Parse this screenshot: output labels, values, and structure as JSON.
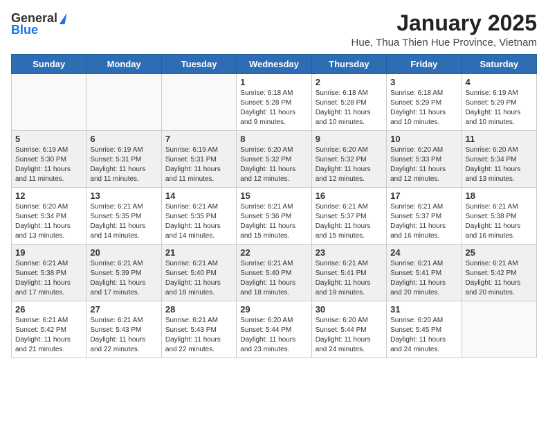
{
  "header": {
    "logo_general": "General",
    "logo_blue": "Blue",
    "month_title": "January 2025",
    "subtitle": "Hue, Thua Thien Hue Province, Vietnam"
  },
  "days_of_week": [
    "Sunday",
    "Monday",
    "Tuesday",
    "Wednesday",
    "Thursday",
    "Friday",
    "Saturday"
  ],
  "weeks": [
    {
      "shaded": false,
      "days": [
        {
          "num": "",
          "info": ""
        },
        {
          "num": "",
          "info": ""
        },
        {
          "num": "",
          "info": ""
        },
        {
          "num": "1",
          "info": "Sunrise: 6:18 AM\nSunset: 5:28 PM\nDaylight: 11 hours and 9 minutes."
        },
        {
          "num": "2",
          "info": "Sunrise: 6:18 AM\nSunset: 5:28 PM\nDaylight: 11 hours and 10 minutes."
        },
        {
          "num": "3",
          "info": "Sunrise: 6:18 AM\nSunset: 5:29 PM\nDaylight: 11 hours and 10 minutes."
        },
        {
          "num": "4",
          "info": "Sunrise: 6:19 AM\nSunset: 5:29 PM\nDaylight: 11 hours and 10 minutes."
        }
      ]
    },
    {
      "shaded": true,
      "days": [
        {
          "num": "5",
          "info": "Sunrise: 6:19 AM\nSunset: 5:30 PM\nDaylight: 11 hours and 11 minutes."
        },
        {
          "num": "6",
          "info": "Sunrise: 6:19 AM\nSunset: 5:31 PM\nDaylight: 11 hours and 11 minutes."
        },
        {
          "num": "7",
          "info": "Sunrise: 6:19 AM\nSunset: 5:31 PM\nDaylight: 11 hours and 11 minutes."
        },
        {
          "num": "8",
          "info": "Sunrise: 6:20 AM\nSunset: 5:32 PM\nDaylight: 11 hours and 12 minutes."
        },
        {
          "num": "9",
          "info": "Sunrise: 6:20 AM\nSunset: 5:32 PM\nDaylight: 11 hours and 12 minutes."
        },
        {
          "num": "10",
          "info": "Sunrise: 6:20 AM\nSunset: 5:33 PM\nDaylight: 11 hours and 12 minutes."
        },
        {
          "num": "11",
          "info": "Sunrise: 6:20 AM\nSunset: 5:34 PM\nDaylight: 11 hours and 13 minutes."
        }
      ]
    },
    {
      "shaded": false,
      "days": [
        {
          "num": "12",
          "info": "Sunrise: 6:20 AM\nSunset: 5:34 PM\nDaylight: 11 hours and 13 minutes."
        },
        {
          "num": "13",
          "info": "Sunrise: 6:21 AM\nSunset: 5:35 PM\nDaylight: 11 hours and 14 minutes."
        },
        {
          "num": "14",
          "info": "Sunrise: 6:21 AM\nSunset: 5:35 PM\nDaylight: 11 hours and 14 minutes."
        },
        {
          "num": "15",
          "info": "Sunrise: 6:21 AM\nSunset: 5:36 PM\nDaylight: 11 hours and 15 minutes."
        },
        {
          "num": "16",
          "info": "Sunrise: 6:21 AM\nSunset: 5:37 PM\nDaylight: 11 hours and 15 minutes."
        },
        {
          "num": "17",
          "info": "Sunrise: 6:21 AM\nSunset: 5:37 PM\nDaylight: 11 hours and 16 minutes."
        },
        {
          "num": "18",
          "info": "Sunrise: 6:21 AM\nSunset: 5:38 PM\nDaylight: 11 hours and 16 minutes."
        }
      ]
    },
    {
      "shaded": true,
      "days": [
        {
          "num": "19",
          "info": "Sunrise: 6:21 AM\nSunset: 5:38 PM\nDaylight: 11 hours and 17 minutes."
        },
        {
          "num": "20",
          "info": "Sunrise: 6:21 AM\nSunset: 5:39 PM\nDaylight: 11 hours and 17 minutes."
        },
        {
          "num": "21",
          "info": "Sunrise: 6:21 AM\nSunset: 5:40 PM\nDaylight: 11 hours and 18 minutes."
        },
        {
          "num": "22",
          "info": "Sunrise: 6:21 AM\nSunset: 5:40 PM\nDaylight: 11 hours and 18 minutes."
        },
        {
          "num": "23",
          "info": "Sunrise: 6:21 AM\nSunset: 5:41 PM\nDaylight: 11 hours and 19 minutes."
        },
        {
          "num": "24",
          "info": "Sunrise: 6:21 AM\nSunset: 5:41 PM\nDaylight: 11 hours and 20 minutes."
        },
        {
          "num": "25",
          "info": "Sunrise: 6:21 AM\nSunset: 5:42 PM\nDaylight: 11 hours and 20 minutes."
        }
      ]
    },
    {
      "shaded": false,
      "days": [
        {
          "num": "26",
          "info": "Sunrise: 6:21 AM\nSunset: 5:42 PM\nDaylight: 11 hours and 21 minutes."
        },
        {
          "num": "27",
          "info": "Sunrise: 6:21 AM\nSunset: 5:43 PM\nDaylight: 11 hours and 22 minutes."
        },
        {
          "num": "28",
          "info": "Sunrise: 6:21 AM\nSunset: 5:43 PM\nDaylight: 11 hours and 22 minutes."
        },
        {
          "num": "29",
          "info": "Sunrise: 6:20 AM\nSunset: 5:44 PM\nDaylight: 11 hours and 23 minutes."
        },
        {
          "num": "30",
          "info": "Sunrise: 6:20 AM\nSunset: 5:44 PM\nDaylight: 11 hours and 24 minutes."
        },
        {
          "num": "31",
          "info": "Sunrise: 6:20 AM\nSunset: 5:45 PM\nDaylight: 11 hours and 24 minutes."
        },
        {
          "num": "",
          "info": ""
        }
      ]
    }
  ]
}
